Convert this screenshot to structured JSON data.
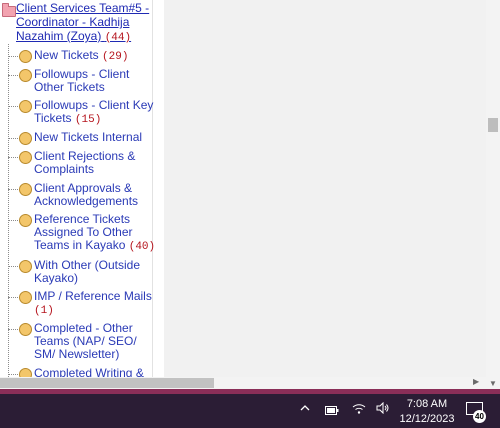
{
  "sidebar": {
    "group": {
      "title": "Client Services Team#5 - Coordinator - Kadhija Nazahim (Zoya)",
      "count": "(44)"
    },
    "items": [
      {
        "label": "New Tickets",
        "count": "(29)"
      },
      {
        "label": "Followups - Client Other Tickets",
        "count": ""
      },
      {
        "label": "Followups - Client Key Tickets",
        "count": "(15)"
      },
      {
        "label": "New Tickets Internal",
        "count": ""
      },
      {
        "label": "Client Rejections & Complaints",
        "count": ""
      },
      {
        "label": "Client Approvals & Acknowledgements",
        "count": ""
      },
      {
        "label": "Reference Tickets Assigned To Other Teams in Kayako",
        "count": "(40)"
      },
      {
        "label": "With Other (Outside Kayako)",
        "count": ""
      },
      {
        "label": "IMP / Reference Mails",
        "count": "(1)"
      },
      {
        "label": "Completed - Other Teams (NAP/ SEO/ SM/ Newsletter)",
        "count": ""
      },
      {
        "label": "Completed Writing &",
        "count": ""
      }
    ]
  },
  "taskbar": {
    "time": "7:08 AM",
    "date": "12/12/2023",
    "notification_count": "40",
    "icons": [
      "chevron-up-icon",
      "battery-icon",
      "wifi-icon",
      "volume-icon",
      "notification-icon"
    ]
  }
}
